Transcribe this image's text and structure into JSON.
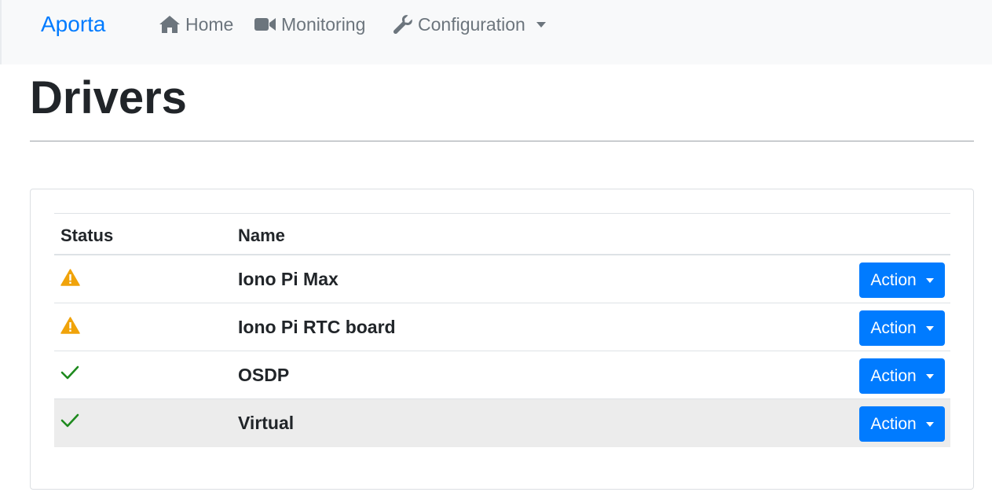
{
  "navbar": {
    "brand": "Aporta",
    "items": [
      {
        "label": "Home",
        "icon": "home-icon"
      },
      {
        "label": "Monitoring",
        "icon": "video-camera-icon"
      },
      {
        "label": "Configuration",
        "icon": "wrench-icon",
        "dropdown": true
      }
    ]
  },
  "page": {
    "title": "Drivers"
  },
  "table": {
    "headers": {
      "status": "Status",
      "name": "Name"
    },
    "rows": [
      {
        "status": "warning",
        "name": "Iono Pi Max",
        "action_label": "Action"
      },
      {
        "status": "warning",
        "name": "Iono Pi RTC board",
        "action_label": "Action"
      },
      {
        "status": "ok",
        "name": "OSDP",
        "action_label": "Action"
      },
      {
        "status": "ok",
        "name": "Virtual",
        "action_label": "Action",
        "highlighted": true
      }
    ]
  },
  "colors": {
    "brand": "#007bff",
    "warning": "#f0a30a",
    "ok": "#1e8a1e",
    "button": "#007bff",
    "navbar_bg": "#f8f9fa"
  }
}
